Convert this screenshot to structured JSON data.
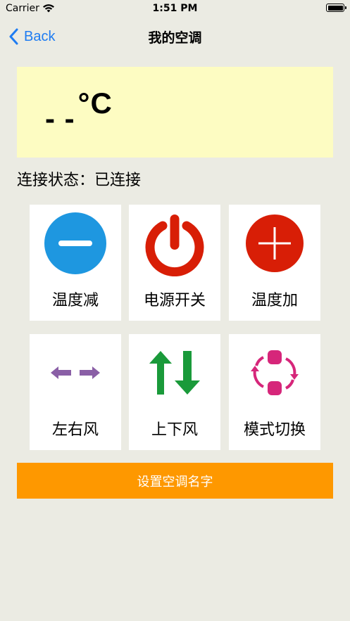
{
  "status_bar": {
    "carrier": "Carrier",
    "time": "1:51 PM"
  },
  "nav": {
    "back_label": "Back",
    "title": "我的空调"
  },
  "temperature": {
    "value": "- -",
    "unit": "°C"
  },
  "connection": {
    "label": "连接状态：",
    "value": "已连接"
  },
  "controls": [
    {
      "label": "温度减",
      "icon": "minus-circle-icon",
      "color": "#1e97e0"
    },
    {
      "label": "电源开关",
      "icon": "power-icon",
      "color": "#d81e06"
    },
    {
      "label": "温度加",
      "icon": "plus-circle-icon",
      "color": "#d81e06"
    },
    {
      "label": "左右风",
      "icon": "horizontal-arrows-icon",
      "color": "#8a5fa6"
    },
    {
      "label": "上下风",
      "icon": "vertical-arrows-icon",
      "color": "#1a9a3a"
    },
    {
      "label": "模式切换",
      "icon": "mode-switch-icon",
      "color": "#d6267a"
    }
  ],
  "rename_button": {
    "label": "设置空调名字"
  },
  "colors": {
    "accent": "#fe9800",
    "link": "#1e7cf2",
    "panel": "#fdfcc2",
    "background": "#ebebe3"
  }
}
